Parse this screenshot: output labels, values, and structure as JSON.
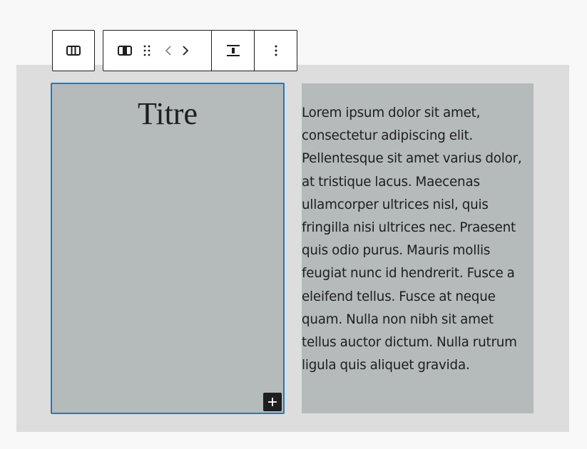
{
  "toolbar": {
    "parent_label": "Select parent block: Columns",
    "column_label": "Column",
    "drag_label": "Drag",
    "move_left_label": "Move left",
    "move_right_label": "Move right",
    "vertical_align_label": "Change vertical alignment",
    "options_label": "Options",
    "icons": {
      "parent": "columns-icon",
      "column": "column-icon",
      "drag": "drag-handle-icon",
      "move_left": "chevron-left-icon",
      "move_right": "chevron-right-icon",
      "align": "align-vertical-center-icon",
      "options": "more-vertical-icon"
    }
  },
  "editor": {
    "heading": "Titre",
    "paragraph": "Lorem ipsum dolor sit amet, consectetur adipiscing elit. Pellentesque sit amet varius dolor, at tristique lacus. Maecenas ullamcorper ultrices nisl, quis fringilla nisi ultrices nec. Praesent quis odio purus. Mauris mollis feugiat nunc id hendrerit. Fusce a eleifend tellus. Fusce at neque quam. Nulla non nibh sit amet tellus auctor dictum. Nulla rutrum ligula quis aliquet gravida.",
    "inserter_label": "Add block",
    "inserter_icon": "plus-icon"
  },
  "colors": {
    "selection_outline": "#1b7cc6",
    "column_background": "#b4bbba",
    "canvas_background": "#dddddd",
    "toolbar_border": "#1e1e1e"
  }
}
